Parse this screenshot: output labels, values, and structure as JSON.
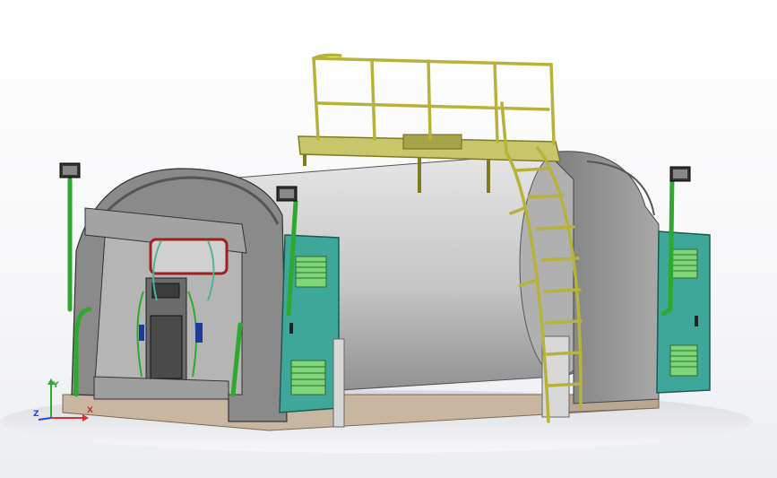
{
  "scene": {
    "background": "#ffffff",
    "colors": {
      "tank_body": "#c9c9c9",
      "tank_shadow": "#8d8d8d",
      "shell": "#9a9a9a",
      "shell_dark": "#6f6f6f",
      "railing": "#b7b23a",
      "railing_dark": "#7f7b1e",
      "pipe": "#2fa82f",
      "door_panel": "#3fa79a",
      "louver": "#7fd67a",
      "base": "#c8b6a0",
      "window_frame": "#a11f1f"
    },
    "icons": [
      "floodlight-icon",
      "floodlight-icon",
      "floodlight-icon",
      "triad-icon"
    ]
  },
  "triad": {
    "x_label": "X",
    "y_label": "Y",
    "z_label": "Z",
    "x_color": "#d83030",
    "y_color": "#2fa82f",
    "z_color": "#2f3fd8"
  }
}
